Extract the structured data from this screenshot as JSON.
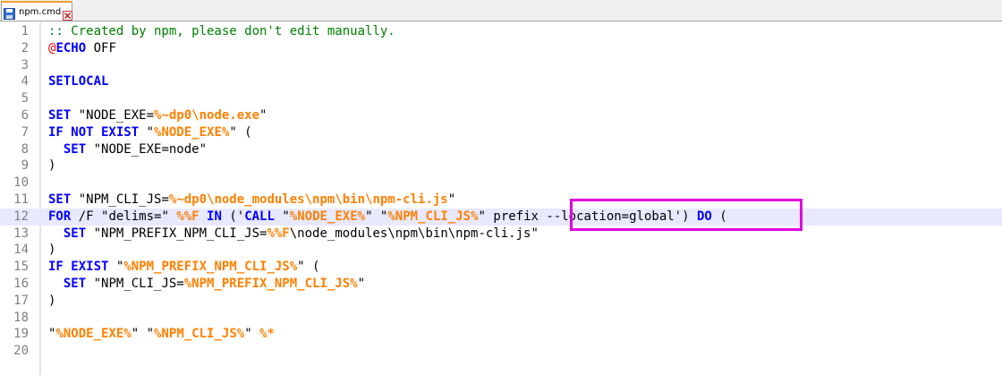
{
  "tab": {
    "title": "npm.cmd",
    "save_icon": "save-icon",
    "close_icon": "close-icon"
  },
  "colors": {
    "comment": "#008000",
    "keyword": "#0000ff",
    "variable": "#ff8000",
    "at": "#ff0000",
    "line_number": "#808080",
    "current_line": "#e8e8ff",
    "highlight_box": "#e000e0"
  },
  "editor": {
    "line_numbers": [
      "1",
      "2",
      "3",
      "4",
      "5",
      "6",
      "7",
      "8",
      "9",
      "10",
      "11",
      "12",
      "13",
      "14",
      "15",
      "16",
      "17",
      "18",
      "19",
      "20"
    ],
    "lines": [
      [
        {
          "t": "comment",
          "s": ":: Created by npm, please don't edit manually."
        }
      ],
      [
        {
          "t": "at",
          "s": "@"
        },
        {
          "t": "kw",
          "s": "ECHO"
        },
        {
          "t": "plain",
          "s": " OFF"
        }
      ],
      [],
      [
        {
          "t": "kw",
          "s": "SETLOCAL"
        }
      ],
      [],
      [
        {
          "t": "kw",
          "s": "SET"
        },
        {
          "t": "plain",
          "s": " \"NODE_EXE="
        },
        {
          "t": "var",
          "s": "%~dp0\\node.exe"
        },
        {
          "t": "plain",
          "s": "\""
        }
      ],
      [
        {
          "t": "kw",
          "s": "IF NOT EXIST"
        },
        {
          "t": "plain",
          "s": " \""
        },
        {
          "t": "var",
          "s": "%NODE_EXE%"
        },
        {
          "t": "plain",
          "s": "\" ("
        }
      ],
      [
        {
          "t": "plain",
          "s": "  "
        },
        {
          "t": "kw",
          "s": "SET"
        },
        {
          "t": "plain",
          "s": " \"NODE_EXE=node\""
        }
      ],
      [
        {
          "t": "plain",
          "s": ")"
        }
      ],
      [],
      [
        {
          "t": "kw",
          "s": "SET"
        },
        {
          "t": "plain",
          "s": " \"NPM_CLI_JS="
        },
        {
          "t": "var",
          "s": "%~dp0\\node_modules\\npm\\bin\\npm-cli.js"
        },
        {
          "t": "plain",
          "s": "\""
        }
      ],
      [
        {
          "t": "kw",
          "s": "FOR"
        },
        {
          "t": "plain",
          "s": " /F \"delims=\" "
        },
        {
          "t": "var",
          "s": "%%F"
        },
        {
          "t": "plain",
          "s": " "
        },
        {
          "t": "kw",
          "s": "IN"
        },
        {
          "t": "plain",
          "s": " ('"
        },
        {
          "t": "kw",
          "s": "CALL"
        },
        {
          "t": "plain",
          "s": " \""
        },
        {
          "t": "var",
          "s": "%NODE_EXE%"
        },
        {
          "t": "plain",
          "s": "\" \""
        },
        {
          "t": "var",
          "s": "%NPM_CLI_JS%"
        },
        {
          "t": "plain",
          "s": "\" prefix --location=global') "
        },
        {
          "t": "kw",
          "s": "DO"
        },
        {
          "t": "plain",
          "s": " ("
        }
      ],
      [
        {
          "t": "plain",
          "s": "  "
        },
        {
          "t": "kw",
          "s": "SET"
        },
        {
          "t": "plain",
          "s": " \"NPM_PREFIX_NPM_CLI_JS="
        },
        {
          "t": "var",
          "s": "%%F"
        },
        {
          "t": "plain",
          "s": "\\node_modules\\npm\\bin\\npm-cli.js\""
        }
      ],
      [
        {
          "t": "plain",
          "s": ")"
        }
      ],
      [
        {
          "t": "kw",
          "s": "IF EXIST"
        },
        {
          "t": "plain",
          "s": " \""
        },
        {
          "t": "var",
          "s": "%NPM_PREFIX_NPM_CLI_JS%"
        },
        {
          "t": "plain",
          "s": "\" ("
        }
      ],
      [
        {
          "t": "plain",
          "s": "  "
        },
        {
          "t": "kw",
          "s": "SET"
        },
        {
          "t": "plain",
          "s": " \"NPM_CLI_JS="
        },
        {
          "t": "var",
          "s": "%NPM_PREFIX_NPM_CLI_JS%"
        },
        {
          "t": "plain",
          "s": "\""
        }
      ],
      [
        {
          "t": "plain",
          "s": ")"
        }
      ],
      [],
      [
        {
          "t": "plain",
          "s": "\""
        },
        {
          "t": "var",
          "s": "%NODE_EXE%"
        },
        {
          "t": "plain",
          "s": "\" \""
        },
        {
          "t": "var",
          "s": "%NPM_CLI_JS%"
        },
        {
          "t": "plain",
          "s": "\" "
        },
        {
          "t": "var",
          "s": "%*"
        }
      ],
      []
    ],
    "current_line": 12
  }
}
